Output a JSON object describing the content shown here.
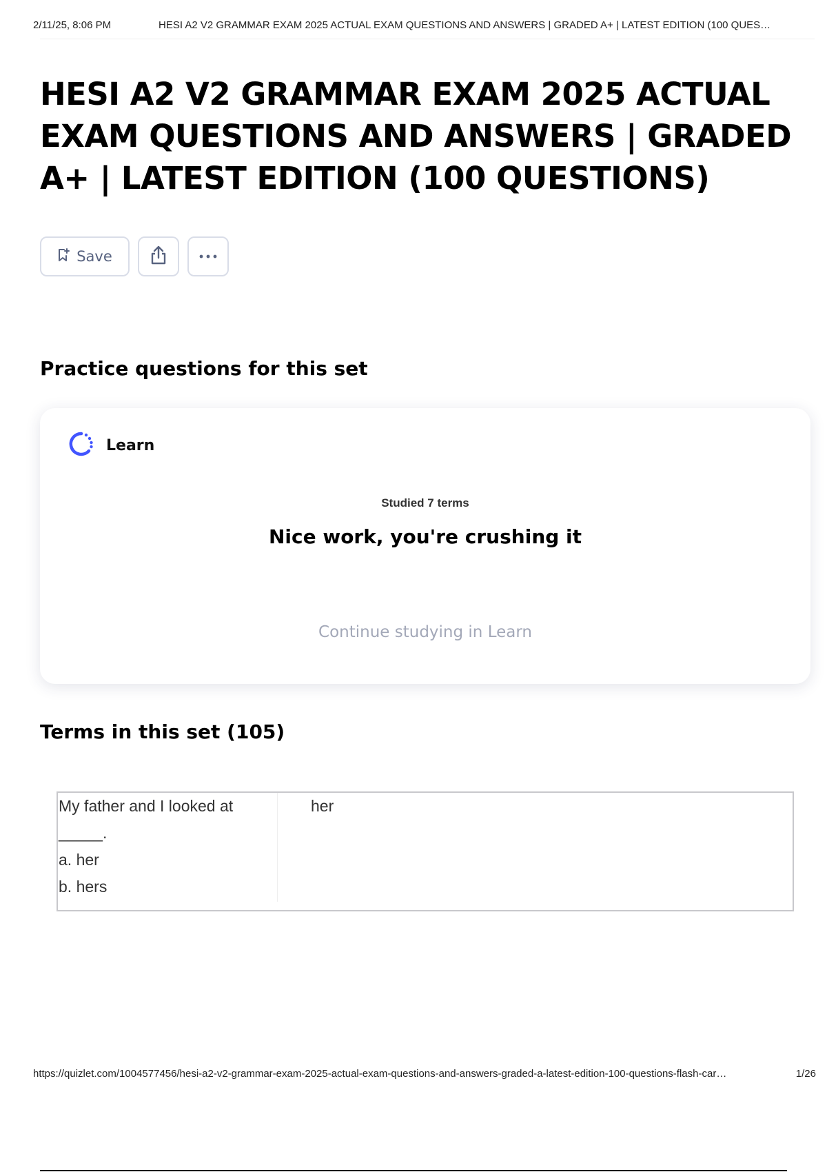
{
  "print_header": {
    "datetime": "2/11/25, 8:06 PM",
    "doc_title": "HESI A2 V2 GRAMMAR EXAM 2025 ACTUAL EXAM QUESTIONS AND ANSWERS | GRADED A+ | LATEST EDITION (100 QUES…"
  },
  "page": {
    "title": "HESI A2 V2 GRAMMAR EXAM 2025 ACTUAL EXAM QUESTIONS AND ANSWERS | GRADED A+ | LATEST EDITION (100 QUESTIONS)"
  },
  "actions": {
    "save_label": "Save",
    "icons": [
      "bookmark-add-icon",
      "share-icon",
      "more-options-icon"
    ]
  },
  "practice": {
    "heading": "Practice questions for this set",
    "learn_label": "Learn",
    "studied_text": "Studied 7 terms",
    "message": "Nice work, you're crushing it",
    "continue_label": "Continue studying in Learn",
    "accent_color": "#4255ff"
  },
  "terms": {
    "heading": "Terms in this set (105)",
    "items": [
      {
        "question_lines": [
          "My father and I looked at",
          "_____.",
          "a. her",
          "b. hers"
        ],
        "answer": "her"
      }
    ]
  },
  "print_footer": {
    "url": "https://quizlet.com/1004577456/hesi-a2-v2-grammar-exam-2025-actual-exam-questions-and-answers-graded-a-latest-edition-100-questions-flash-car…",
    "page_number": "1/26"
  }
}
